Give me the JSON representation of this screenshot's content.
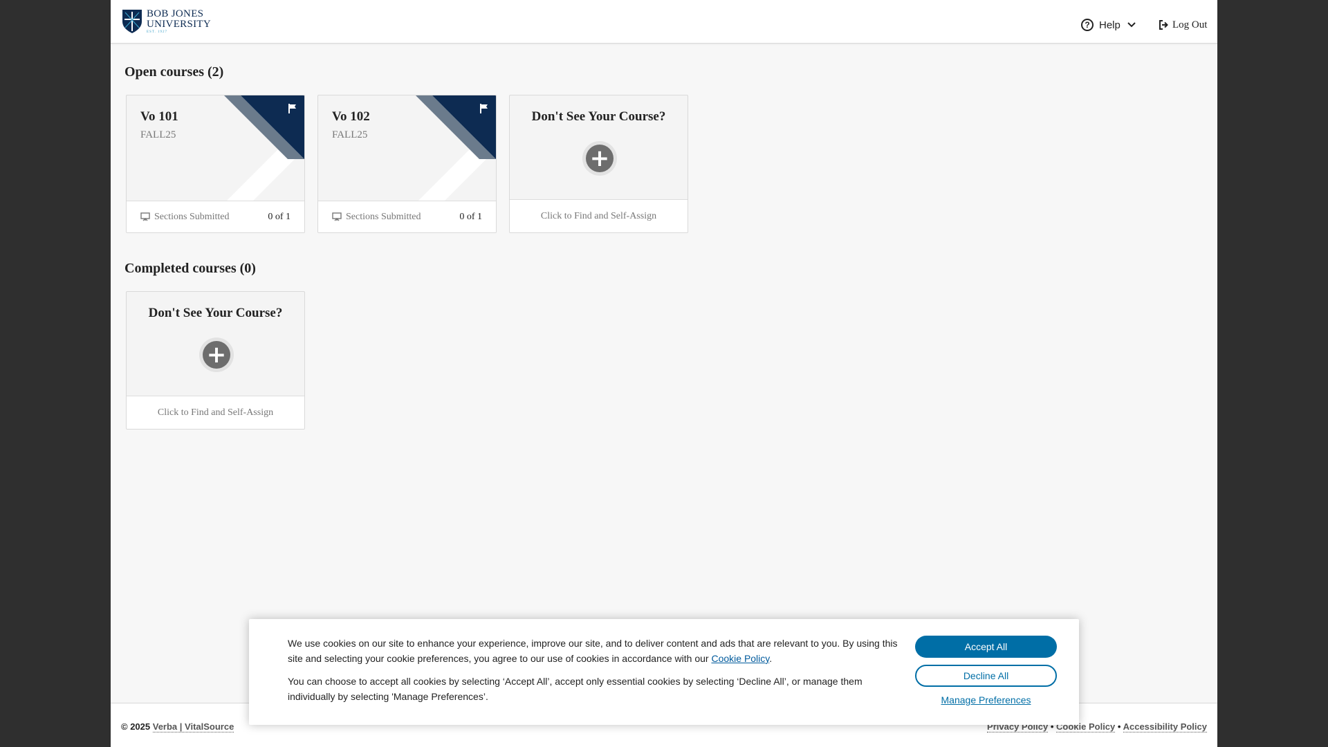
{
  "header": {
    "logo": {
      "line1": "BOB JONES",
      "line2": "UNIVERSITY",
      "line3": "EST. 1927"
    },
    "help_label": "Help",
    "logout_label": "Log Out"
  },
  "open_courses": {
    "title": "Open courses (2)",
    "cards": [
      {
        "name": "Vo 101",
        "term": "FALL25",
        "footer_label": "Sections Submitted",
        "footer_value": "0 of 1"
      },
      {
        "name": "Vo 102",
        "term": "FALL25",
        "footer_label": "Sections Submitted",
        "footer_value": "0 of 1"
      }
    ],
    "add_card": {
      "title": "Don't See Your Course?",
      "action": "Click to Find and Self-Assign"
    }
  },
  "completed_courses": {
    "title": "Completed courses (0)",
    "add_card": {
      "title": "Don't See Your Course?",
      "action": "Click to Find and Self-Assign"
    }
  },
  "cookie_banner": {
    "p1_before": "We use cookies on our site to enhance your experience, improve our site, and to deliver content and ads that are relevant to you. By using this site and selecting your cookie preferences, you agree to our use of cookies in accordance with our ",
    "p1_link": "Cookie Policy",
    "p1_after": ".",
    "p2": "You can choose to accept all cookies by selecting ‘Accept All’, accept only essential cookies by selecting ‘Decline All’, or manage them individually by selecting 'Manage Preferences’.",
    "accept_label": "Accept All",
    "decline_label": "Decline All",
    "manage_label": "Manage Preferences"
  },
  "footer": {
    "copyright": "© 2025",
    "brand_link": "Verba | VitalSource",
    "links": [
      "Privacy Policy",
      "Cookie Policy",
      "Accessibility Policy"
    ],
    "separator": "•"
  },
  "colors": {
    "brand_navy": "#0d2b52",
    "accent_blue": "#006ea6",
    "stripe_gray": "#6b7b8c"
  },
  "icons": {
    "help": "question-circle-icon",
    "logout": "sign-out-icon",
    "flag": "flag-icon",
    "sections": "presentation-board-icon",
    "add": "plus-circle-icon"
  }
}
